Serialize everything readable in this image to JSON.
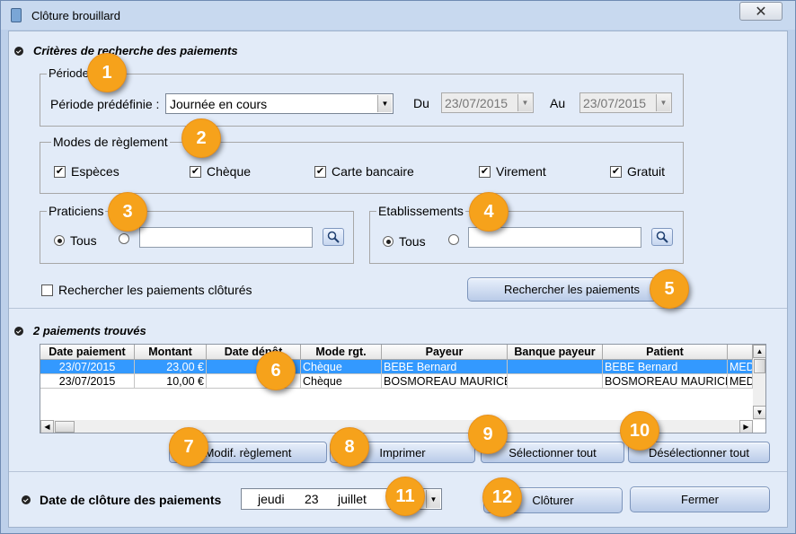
{
  "window": {
    "title": "Clôture brouillard",
    "close_glyph": "✕"
  },
  "search": {
    "title": "Critères de recherche des paiements",
    "periode": {
      "legend": "Période",
      "predef_label": "Période prédéfinie :",
      "predef_value": "Journée en cours",
      "du_label": "Du",
      "du_value": "23/07/2015",
      "au_label": "Au",
      "au_value": "23/07/2015"
    },
    "modes": {
      "legend": "Modes de règlement",
      "items": [
        {
          "label": "Espèces",
          "checked": true
        },
        {
          "label": "Chèque",
          "checked": true
        },
        {
          "label": "Carte bancaire",
          "checked": true
        },
        {
          "label": "Virement",
          "checked": true
        },
        {
          "label": "Gratuit",
          "checked": true
        }
      ]
    },
    "praticiens": {
      "legend": "Praticiens",
      "tous_label": "Tous",
      "value": ""
    },
    "etablissements": {
      "legend": "Etablissements",
      "tous_label": "Tous",
      "value": ""
    },
    "closed_label": "Rechercher les paiements clôturés",
    "closed_checked": false,
    "search_button": "Rechercher les paiements"
  },
  "results": {
    "title": "2 paiements trouvés",
    "columns": [
      "Date paiement",
      "Montant",
      "Date dépôt",
      "Mode rgt.",
      "Payeur",
      "Banque payeur",
      "Patient",
      ""
    ],
    "rows": [
      [
        "23/07/2015",
        "23,00 €",
        "",
        "Chèque",
        "BEBE Bernard",
        "",
        "BEBE Bernard",
        "MED"
      ],
      [
        "23/07/2015",
        "10,00 €",
        "",
        "Chèque",
        "BOSMOREAU MAURICE",
        "",
        "BOSMOREAU MAURICE",
        "MED"
      ]
    ],
    "buttons": {
      "modif": "Modif. règlement",
      "print": "Imprimer",
      "select_all": "Sélectionner tout",
      "deselect_all": "Désélectionner tout"
    }
  },
  "closing": {
    "title": "Date de clôture des paiements",
    "day_name": "jeudi",
    "day": "23",
    "month": "juillet",
    "close_button": "Clôturer",
    "exit_button": "Fermer"
  },
  "callouts": [
    "1",
    "2",
    "3",
    "4",
    "5",
    "6",
    "7",
    "8",
    "9",
    "10",
    "11",
    "12"
  ],
  "colors": {
    "callout": "#f6a21b",
    "selection": "#3399ff",
    "window_bg": "#e2ebf8"
  }
}
